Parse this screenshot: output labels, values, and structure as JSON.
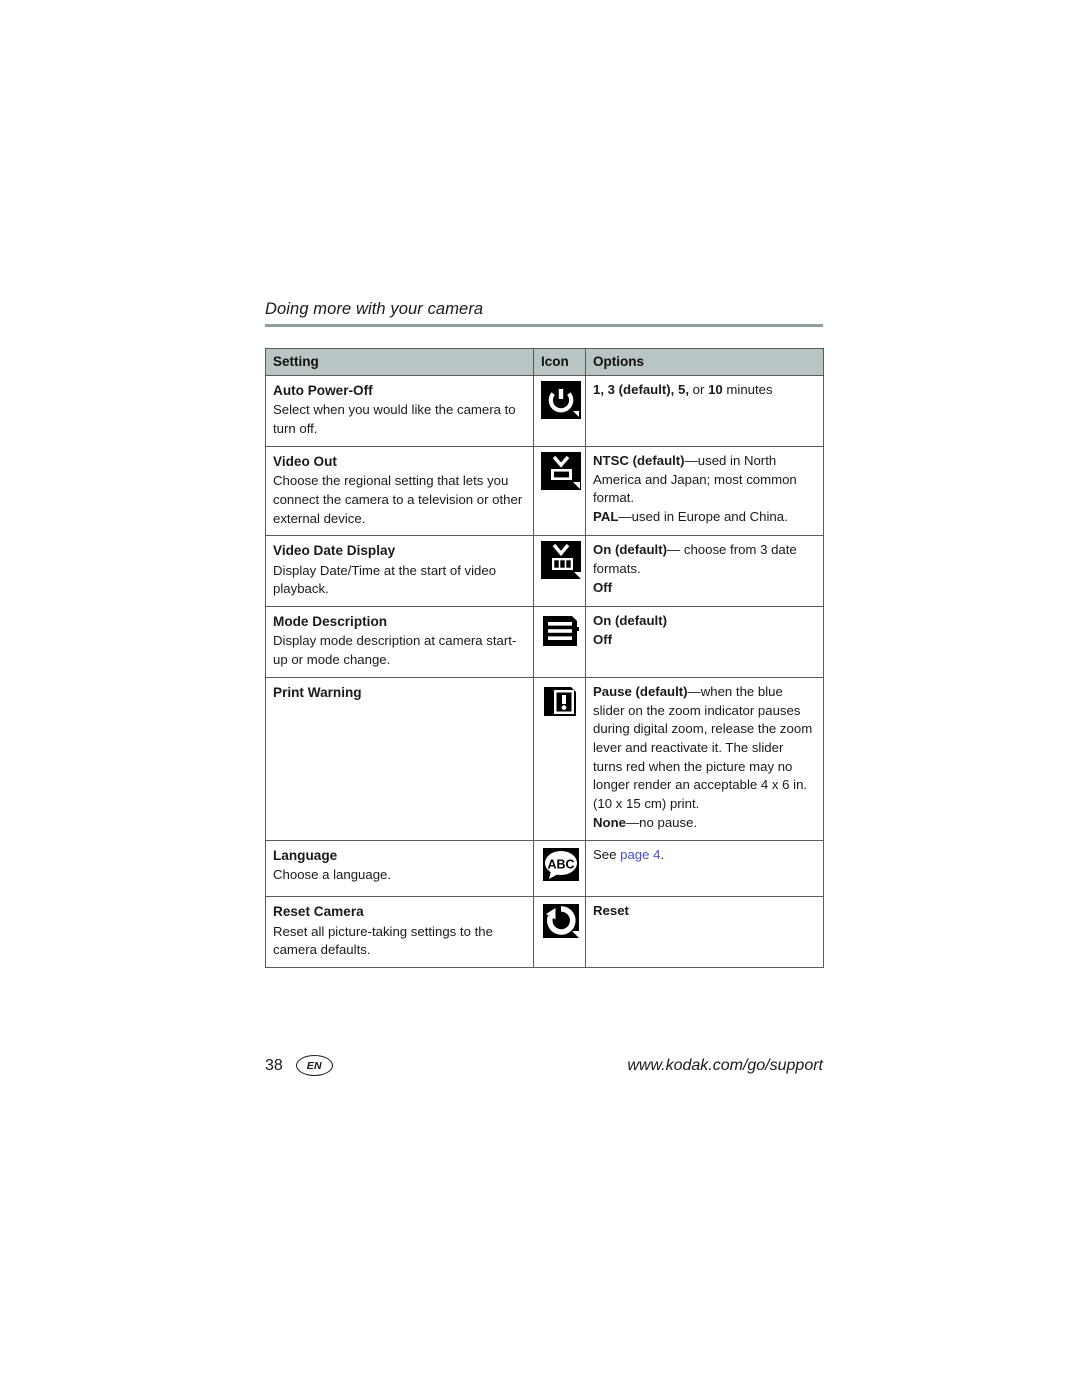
{
  "running_head": "Doing more with your camera",
  "table": {
    "headers": {
      "setting": "Setting",
      "icon": "Icon",
      "options": "Options"
    },
    "rows": [
      {
        "name": "Auto Power-Off",
        "desc": "Select when you would like the camera to turn off.",
        "icon": "power-icon",
        "options": [
          {
            "bold": "1, 3 (default), 5,",
            "rest": " or ",
            "bold2": "10",
            "rest2": " minutes"
          }
        ]
      },
      {
        "name": "Video Out",
        "desc": "Choose the regional setting that lets you connect the camera to a television or other external device.",
        "icon": "tv-icon",
        "options": [
          {
            "bold": "NTSC (default)",
            "rest": "—used in North America and Japan; most common format."
          },
          {
            "bold": "PAL",
            "rest": "—used in Europe and China."
          }
        ]
      },
      {
        "name": "Video Date Display",
        "desc": "Display Date/Time at the start of video playback.",
        "icon": "tv-date-icon",
        "options": [
          {
            "bold": "On (default)",
            "rest": "— choose from 3 date formats."
          },
          {
            "bold": "Off",
            "rest": ""
          }
        ]
      },
      {
        "name": "Mode Description",
        "desc": "Display mode description at camera start-up or mode change.",
        "icon": "lines-icon",
        "options": [
          {
            "bold": "On (default)",
            "rest": ""
          },
          {
            "bold": "Off",
            "rest": ""
          }
        ]
      },
      {
        "name": "Print Warning",
        "desc": "",
        "icon": "print-warning-icon",
        "options": [
          {
            "bold": "Pause (default)",
            "rest": "—when the blue slider on the zoom indicator pauses during digital zoom, release the zoom lever and reactivate it. The slider turns red when the picture may no longer render an acceptable 4 x 6 in. (10 x 15 cm) print."
          },
          {
            "bold": "None",
            "rest": "—no pause."
          }
        ]
      },
      {
        "name": "Language",
        "desc": "Choose a language.",
        "icon": "abc-bubble-icon",
        "options": [
          {
            "bold": "",
            "rest": "See ",
            "link": "page 4",
            "rest2": "."
          }
        ]
      },
      {
        "name": "Reset Camera",
        "desc": "Reset all picture-taking settings to the camera defaults.",
        "icon": "reset-icon",
        "options": [
          {
            "bold": "Reset",
            "rest": ""
          }
        ]
      }
    ]
  },
  "footer": {
    "page_number": "38",
    "language_badge": "EN",
    "url": "www.kodak.com/go/support"
  },
  "colors": {
    "header_fill": "#b9c4c4",
    "rule": "#8e9e9b",
    "border": "#5a5a5a",
    "link": "#4b4bd6"
  }
}
